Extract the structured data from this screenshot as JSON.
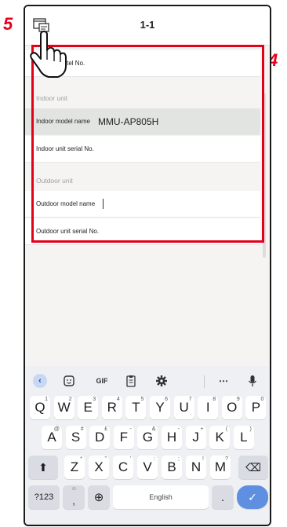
{
  "header": {
    "title": "1-1",
    "settings_icon": "settings-window-icon"
  },
  "callouts": {
    "step5": "5",
    "step4": "4"
  },
  "form": {
    "contact_label": "Contact tel No.",
    "contact_label_visible": "tact tel No.",
    "indoor_section": "Indoor unit",
    "indoor_model_label": "Indoor model name",
    "indoor_model_value": "MMU-AP805H",
    "indoor_serial_label": "Indoor unit serial No.",
    "outdoor_section": "Outdoor unit",
    "outdoor_model_label": "Outdoor model name",
    "outdoor_serial_label": "Outdoor unit serial No."
  },
  "keyboard": {
    "toolbar": [
      "back-icon",
      "sticker-icon",
      "GIF",
      "clipboard-icon",
      "gear-icon",
      "more-icon",
      "mic-icon"
    ],
    "gif_label": "GIF",
    "row1": [
      {
        "k": "Q",
        "h": "1"
      },
      {
        "k": "W",
        "h": "2"
      },
      {
        "k": "E",
        "h": "3"
      },
      {
        "k": "R",
        "h": "4"
      },
      {
        "k": "T",
        "h": "5"
      },
      {
        "k": "Y",
        "h": "6"
      },
      {
        "k": "U",
        "h": "7"
      },
      {
        "k": "I",
        "h": "8"
      },
      {
        "k": "O",
        "h": "9"
      },
      {
        "k": "P",
        "h": "0"
      }
    ],
    "row2": [
      {
        "k": "A",
        "h": "@"
      },
      {
        "k": "S",
        "h": "#"
      },
      {
        "k": "D",
        "h": "£"
      },
      {
        "k": "F",
        "h": "-"
      },
      {
        "k": "G",
        "h": "&"
      },
      {
        "k": "H",
        "h": "-"
      },
      {
        "k": "J",
        "h": "+"
      },
      {
        "k": "K",
        "h": "("
      },
      {
        "k": "L",
        "h": ")"
      }
    ],
    "row3": [
      {
        "k": "Z",
        "h": "*"
      },
      {
        "k": "X",
        "h": "\""
      },
      {
        "k": "C",
        "h": "'"
      },
      {
        "k": "V",
        "h": ":"
      },
      {
        "k": "B",
        "h": ";"
      },
      {
        "k": "N",
        "h": "!"
      },
      {
        "k": "M",
        "h": "?"
      }
    ],
    "symbols_label": "?123",
    "comma_label": ",",
    "space_label": "English",
    "period_label": ".",
    "shift_icon": "shift-icon",
    "backspace_icon": "backspace-icon",
    "globe_icon": "globe-icon",
    "enter_icon": "enter-check-icon",
    "accent_color": "#5f8fe0",
    "callout_color": "#e3001b"
  }
}
